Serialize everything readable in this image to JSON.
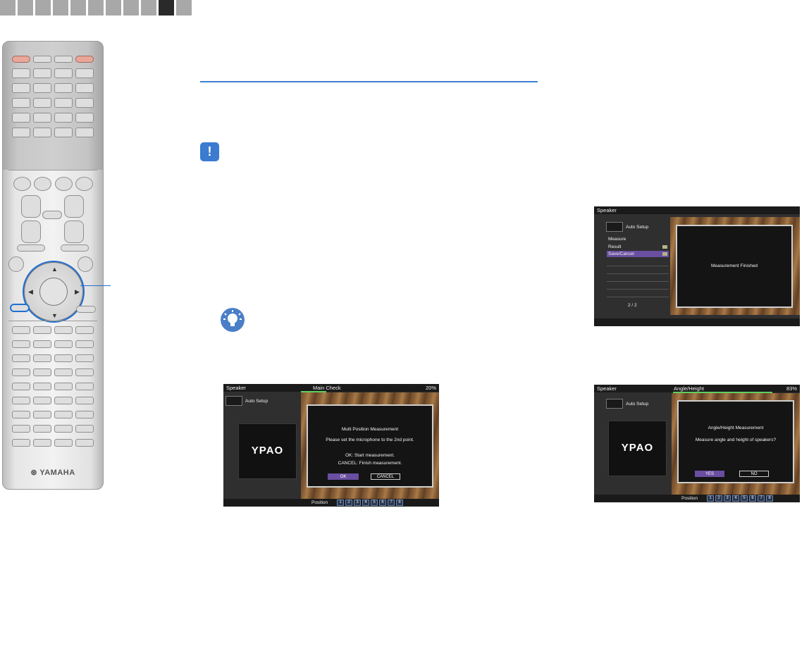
{
  "tabs": {
    "count": 11,
    "active_index": 9
  },
  "remote": {
    "brand": "YAMAHA"
  },
  "icons": {
    "notice": "exclamation-icon",
    "hint": "lightbulb-icon",
    "notice_glyph": "!"
  },
  "screens": {
    "main_check": {
      "header": "Speaker",
      "step": "Main Check",
      "progress": "20%",
      "progress_fraction": 0.2,
      "auto_setup": "Auto Setup",
      "logo": "YPAO",
      "title": "Multi Position Measurement",
      "instruction": "Please set the microphone to the 2nd point.",
      "ok_line": "OK:   Start measurement.",
      "cancel_line": "CANCEL:  Finish measurement.",
      "ok_button": "OK",
      "cancel_button": "CANCEL",
      "position_label": "Position",
      "positions": [
        "1",
        "2",
        "3",
        "4",
        "5",
        "6",
        "7",
        "8"
      ]
    },
    "result": {
      "header": "Speaker",
      "auto_setup": "Auto Setup",
      "menu_heading": "Measure",
      "menu_items": [
        "Result",
        "Save/Cancel"
      ],
      "selected_index": 1,
      "page": "2 / 2",
      "message": "Measurement Finished"
    },
    "angle_height": {
      "header": "Speaker",
      "step": "Angle/Height",
      "progress": "83%",
      "progress_fraction": 0.83,
      "auto_setup": "Auto Setup",
      "logo": "YPAO",
      "title": "Angle/Height Measurement",
      "question": "Measure angle and height of speakers?",
      "yes_button": "YES",
      "no_button": "NO",
      "position_label": "Position",
      "positions": [
        "1",
        "2",
        "3",
        "4",
        "5",
        "6",
        "7",
        "8"
      ]
    }
  }
}
